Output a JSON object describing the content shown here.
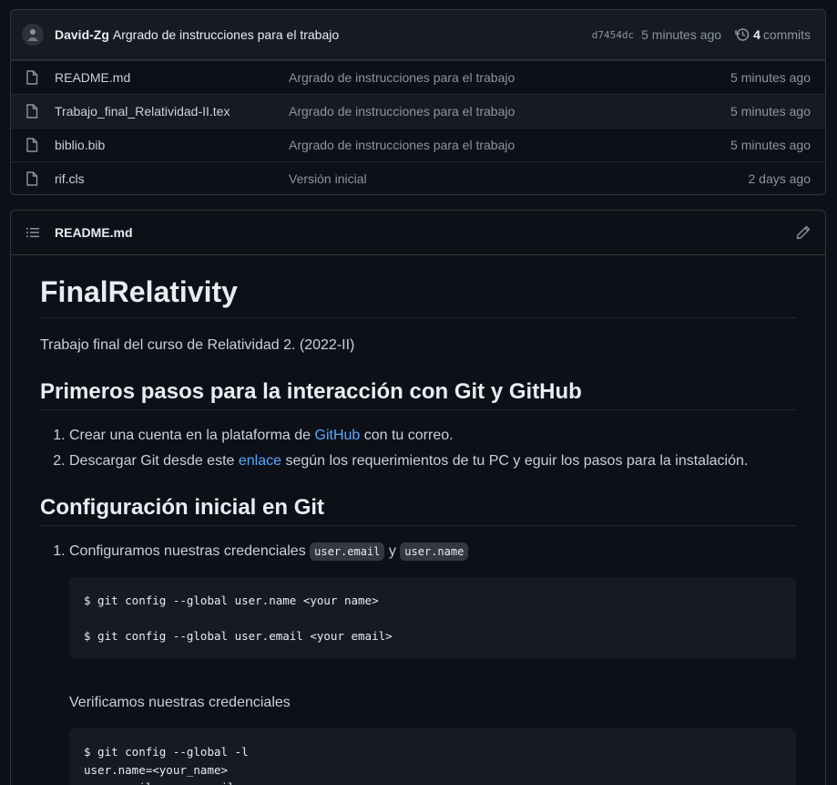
{
  "commit": {
    "author": "David-Zg",
    "message": "Argrado de instrucciones para el trabajo",
    "sha": "d7454dc",
    "time": "5 minutes ago",
    "commit_count": "4",
    "commits_label": "commits"
  },
  "files": [
    {
      "name": "README.md",
      "message": "Argrado de instrucciones para el trabajo",
      "time": "5 minutes ago"
    },
    {
      "name": "Trabajo_final_Relatividad-II.tex",
      "message": "Argrado de instrucciones para el trabajo",
      "time": "5 minutes ago"
    },
    {
      "name": "biblio.bib",
      "message": "Argrado de instrucciones para el trabajo",
      "time": "5 minutes ago"
    },
    {
      "name": "rif.cls",
      "message": "Versión inicial",
      "time": "2 days ago"
    }
  ],
  "readme": {
    "header": "README.md",
    "title": "FinalRelativity",
    "intro": "Trabajo final del curso de Relatividad 2. (2022-II)",
    "section1": {
      "heading": "Primeros pasos para la interacción con Git y GitHub",
      "item1_pre": "Crear una cuenta en la plataforma de ",
      "item1_link": "GitHub",
      "item1_post": " con tu correo.",
      "item2_pre": "Descargar Git desde este ",
      "item2_link": "enlace",
      "item2_post": " según los requerimientos de tu PC y eguir los pasos para la instalación."
    },
    "section2": {
      "heading": "Configuración inicial en Git",
      "item1_pre": "Configuramos nuestras credenciales ",
      "code1": "user.email",
      "item1_mid": " y ",
      "code2": "user.name",
      "block1": "$ git config --global user.name <your name>\n\n$ git config --global user.email <your email>",
      "verify": "Verificamos nuestras credenciales",
      "block2": "$ git config --global -l\nuser.name=<your_name>\nuser.email=<your_email>"
    }
  },
  "colors": {
    "accent": "#58a6ff",
    "background": "#0d1117",
    "panel": "#161b22",
    "border": "#30363d"
  }
}
